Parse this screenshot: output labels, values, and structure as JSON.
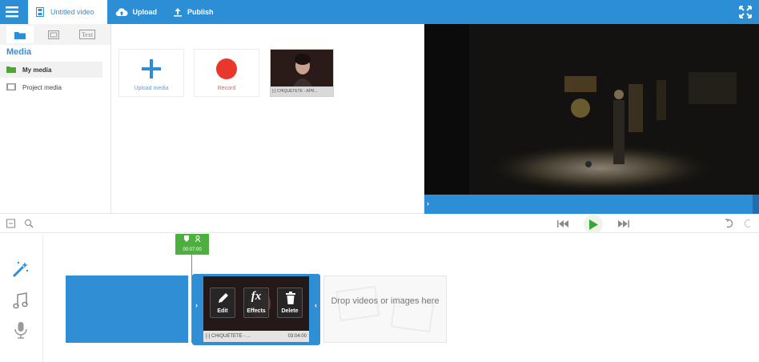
{
  "topbar": {
    "project_title": "Untitled video",
    "upload_label": "Upload",
    "publish_label": "Publish"
  },
  "media_panel": {
    "tab_text_label": "Text",
    "heading": "Media",
    "items": [
      {
        "label": "My media",
        "icon": "folder-icon",
        "selected": true
      },
      {
        "label": "Project media",
        "icon": "film-strip-icon",
        "selected": false
      }
    ],
    "upload_card_label": "Upload media",
    "record_card_label": "Record",
    "clip_card_caption": "[-] CHIQUETETE - APR..."
  },
  "timeline": {
    "marker_time": "00:07:00",
    "clip_buttons": [
      {
        "label": "Edit",
        "icon": "pencil-icon"
      },
      {
        "label": "Effects",
        "icon": "fx-icon"
      },
      {
        "label": "Delete",
        "icon": "trash-icon"
      }
    ],
    "clip_name": "[-] CHIQUETETE - ...",
    "clip_duration": "03:04:00",
    "drop_text": "Drop videos or images here"
  },
  "colors": {
    "accent": "#2c8fd6",
    "record": "#e9372b",
    "marker": "#4caf3e"
  }
}
